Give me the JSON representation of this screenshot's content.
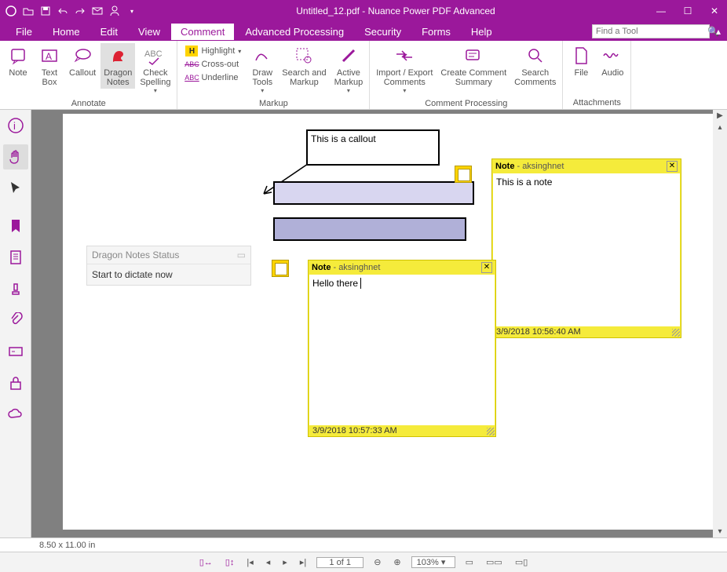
{
  "titlebar": {
    "title": "Untitled_12.pdf - Nuance Power PDF Advanced"
  },
  "menu": {
    "file": "File",
    "home": "Home",
    "edit": "Edit",
    "view": "View",
    "comment": "Comment",
    "advanced": "Advanced Processing",
    "security": "Security",
    "forms": "Forms",
    "help": "Help",
    "search_placeholder": "Find a Tool"
  },
  "ribbon": {
    "annotate": {
      "label": "Annotate",
      "note": "Note",
      "textbox": "Text\nBox",
      "callout": "Callout",
      "dragon": "Dragon\nNotes",
      "spell": "Check\nSpelling"
    },
    "markup": {
      "label": "Markup",
      "highlight": "Highlight",
      "crossout": "Cross-out",
      "underline": "Underline",
      "drawtools": "Draw\nTools",
      "search": "Search and\nMarkup",
      "active": "Active\nMarkup"
    },
    "processing": {
      "label": "Comment Processing",
      "import": "Import / Export\nComments",
      "summary": "Create Comment\nSummary",
      "searchc": "Search\nComments"
    },
    "attach": {
      "label": "Attachments",
      "file": "File",
      "audio": "Audio"
    }
  },
  "dragon": {
    "header": "Dragon Notes Status",
    "body": "Start to dictate now"
  },
  "callout": {
    "text": "This is a callout"
  },
  "note1": {
    "title": "Note",
    "author": "aksinghnet",
    "body": "This is a note",
    "timestamp": "3/9/2018 10:56:40 AM"
  },
  "note2": {
    "title": "Note",
    "author": "aksinghnet",
    "body": "Hello there",
    "timestamp": "3/9/2018 10:57:33 AM"
  },
  "footer": {
    "dims": "8.50 x 11.00 in",
    "page": "1 of 1",
    "zoom": "103%"
  }
}
